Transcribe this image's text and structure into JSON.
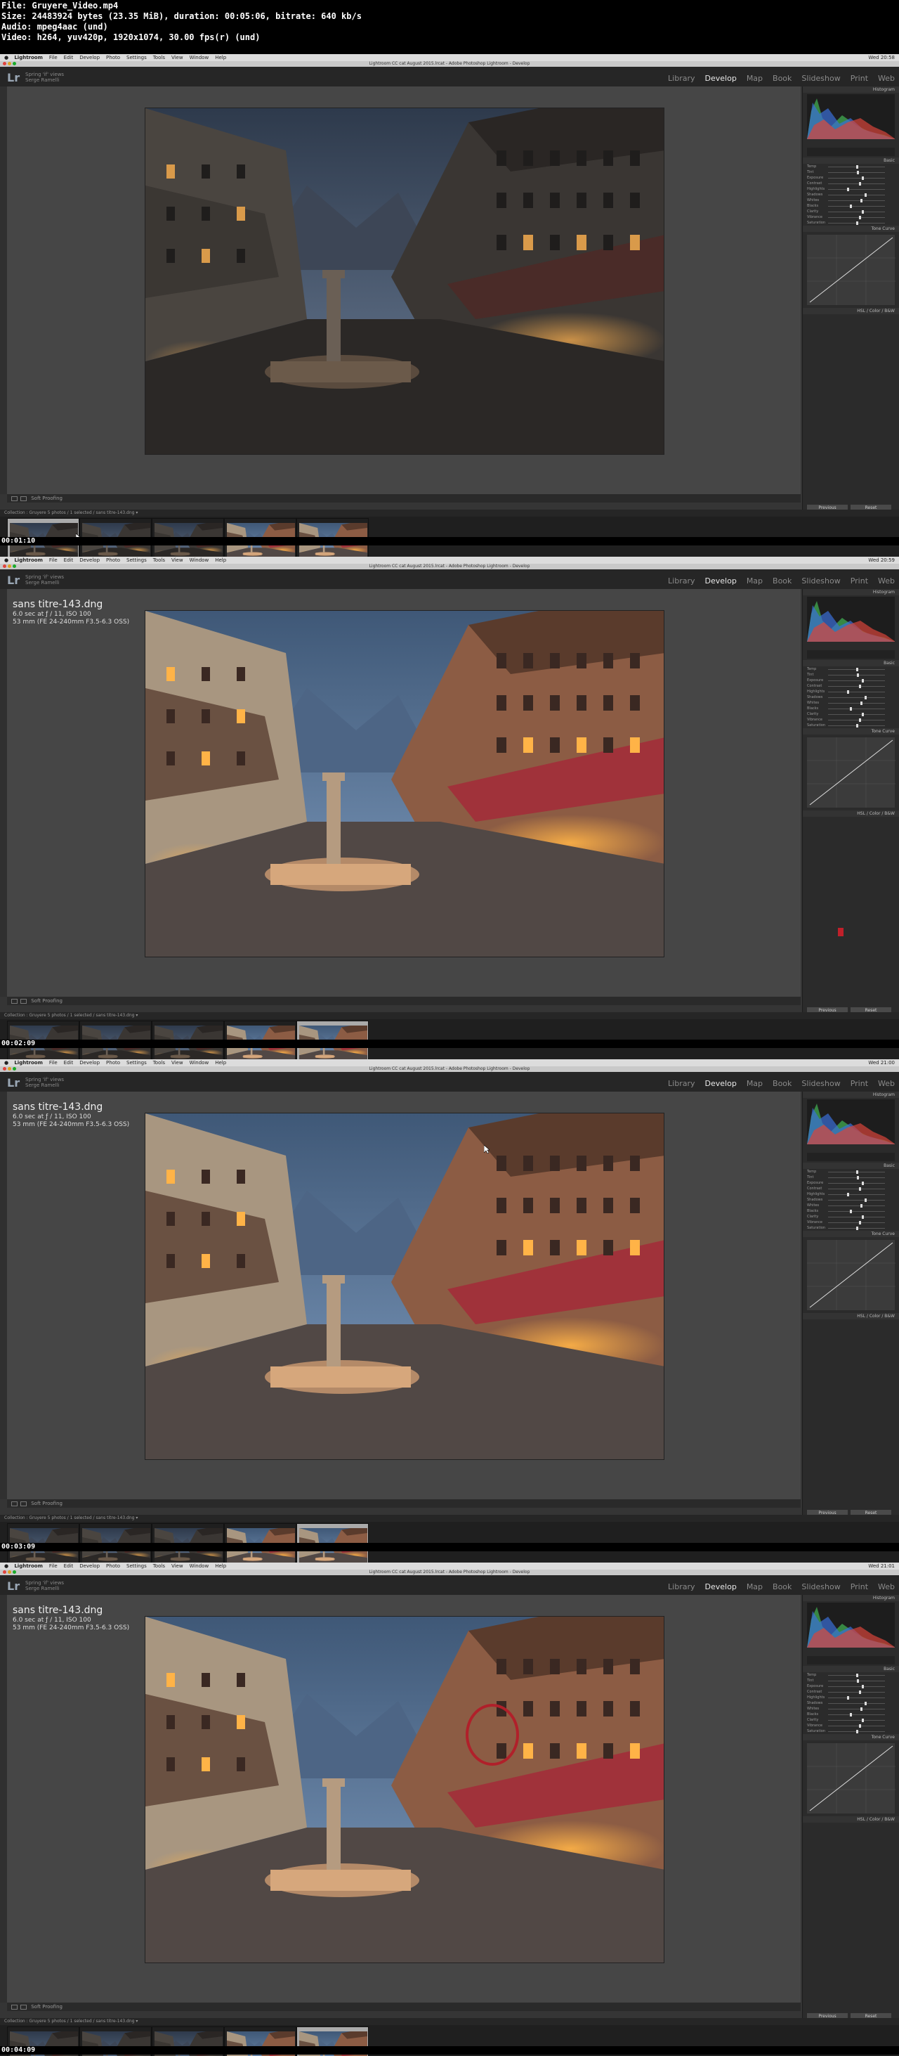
{
  "header": {
    "lines": [
      "File: Gruyere_Video.mp4",
      "Size: 24483924 bytes (23.35 MiB), duration: 00:05:06, bitrate: 640 kb/s",
      "Audio: mpeg4aac (und)",
      "Video: h264, yuv420p, 1920x1074, 30.00 fps(r) (und)"
    ]
  },
  "app": {
    "menu": [
      "Lightroom",
      "File",
      "Edit",
      "Develop",
      "Photo",
      "Settings",
      "Tools",
      "View",
      "Window",
      "Help"
    ],
    "window_title": "Lightroom CC cat August 2015.lrcat - Adobe Photoshop Lightroom - Develop",
    "identity": [
      "Spring 'if' views",
      "Serge Ramelli"
    ],
    "logo": "Lr",
    "modules": [
      "Library",
      "Develop",
      "Map",
      "Book",
      "Slideshow",
      "Print",
      "Web"
    ],
    "active_module": "Develop",
    "toolbar_label": "Soft Proofing",
    "panel_histogram": "Histogram",
    "panel_basic": "Basic",
    "panel_tonecurve": "Tone Curve",
    "panel_hsl": "HSL / Color / B&W",
    "btn_previous": "Previous",
    "btn_reset": "Reset",
    "basic_sliders": [
      "Temp",
      "Tint",
      "Exposure",
      "Contrast",
      "Highlights",
      "Shadows",
      "Whites",
      "Blacks",
      "Clarity",
      "Vibrance",
      "Saturation"
    ]
  },
  "photo_info": {
    "filename": "sans titre-143.dng",
    "exposure": "6.0 sec at ƒ / 11, ISO 100",
    "lens": "53 mm (FE 24-240mm F3.5-6.3 OSS)"
  },
  "frames": [
    {
      "timestamp": "00:01:10",
      "clock": "Wed 20:58",
      "show_info": false,
      "selected_thumb": 0,
      "filmstrip": "Collection : Gruyere    5 photos / 1 selected / sans titre-143.dng ▾",
      "cursor": "filmstrip"
    },
    {
      "timestamp": "00:02:09",
      "clock": "Wed 20:59",
      "show_info": true,
      "selected_thumb": 4,
      "filmstrip": "Collection : Gruyere    5 photos / 1 selected / sans titre-143.dng ▾",
      "cursor": "panel"
    },
    {
      "timestamp": "00:03:09",
      "clock": "Wed 21:00",
      "show_info": true,
      "selected_thumb": 4,
      "filmstrip": "Collection : Gruyere    5 photos / 1 selected / sans titre-143.dng ▾",
      "cursor": "photo"
    },
    {
      "timestamp": "00:04:09",
      "clock": "Wed 21:01",
      "show_info": true,
      "selected_thumb": 4,
      "filmstrip": "Collection : Gruyere    5 photos / 1 selected / sans titre-143.dng ▾",
      "cursor": "photo-circle"
    }
  ]
}
